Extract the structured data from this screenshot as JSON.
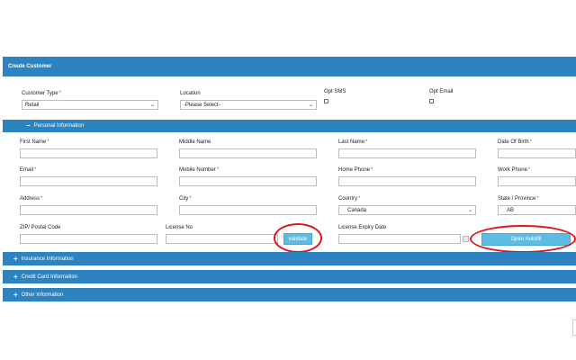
{
  "header": {
    "title": "Create Customer"
  },
  "top_row": {
    "customer_type": {
      "label": "Customer Type",
      "value": "Retail"
    },
    "location": {
      "label": "Location",
      "value": "-Please Select-"
    },
    "opt_sms": {
      "label": "Opt SMS"
    },
    "opt_email": {
      "label": "Opt Email"
    }
  },
  "personal": {
    "title": "Personal Information",
    "toggle": "−",
    "fields": {
      "first_name": "First Name",
      "middle_name": "Middle Name",
      "last_name": "Last Name",
      "dob": "Date Of Birth",
      "email": "Email",
      "mobile": "Mobile Number",
      "home_phone": "Home Phone",
      "work_phone": "Work Phone",
      "address": "Address",
      "city": "City",
      "country": "Country",
      "country_value": "Canada",
      "state": "State / Province",
      "state_value": "AB",
      "zip": "ZIP/ Postal Code",
      "license_no": "License No",
      "license_expiry": "License Expiry Date"
    },
    "required_marker": "*",
    "validate_label": "validate",
    "autofill_label": "Open Autofill"
  },
  "sections": [
    {
      "label": "Insurance Information",
      "toggle": "+"
    },
    {
      "label": "Credit Card Information",
      "toggle": "+"
    },
    {
      "label": "Other Information",
      "toggle": "+"
    }
  ],
  "colors": {
    "bar": "#2d82c0",
    "button": "#5bbde4",
    "highlight": "#e0141c"
  }
}
